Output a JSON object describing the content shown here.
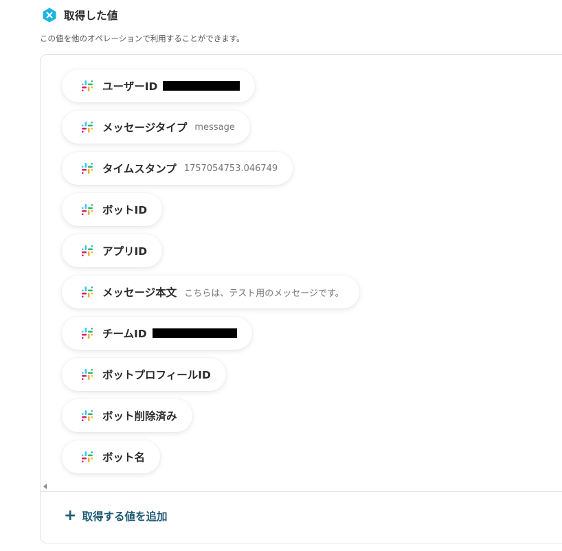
{
  "header": {
    "title": "取得した値",
    "subtitle": "この値を他のオペレーションで利用することができます。",
    "icon": "hexagon-x-icon",
    "accent_color": "#1cb4e0"
  },
  "chips": [
    {
      "label": "ユーザーID",
      "value": "",
      "redacted": true
    },
    {
      "label": "メッセージタイプ",
      "value": "message",
      "redacted": false
    },
    {
      "label": "タイムスタンプ",
      "value": "1757054753.046749",
      "redacted": false
    },
    {
      "label": "ボットID",
      "value": "",
      "redacted": false
    },
    {
      "label": "アプリID",
      "value": "",
      "redacted": false
    },
    {
      "label": "メッセージ本文",
      "value": "こちらは、テスト用のメッセージです。",
      "redacted": false
    },
    {
      "label": "チームID",
      "value": "",
      "redacted": true
    },
    {
      "label": "ボットプロフィールID",
      "value": "",
      "redacted": false
    },
    {
      "label": "ボット削除済み",
      "value": "",
      "redacted": false
    },
    {
      "label": "ボット名",
      "value": "",
      "redacted": false
    }
  ],
  "chip_icon": "slack-icon",
  "add_button": {
    "label": "取得する値を追加",
    "icon": "plus-icon"
  },
  "colors": {
    "slack_blue": "#36c5f0",
    "slack_green": "#2eb67d",
    "slack_yellow": "#ecb22e",
    "slack_red": "#e01e5a",
    "link": "#1d5a73"
  }
}
